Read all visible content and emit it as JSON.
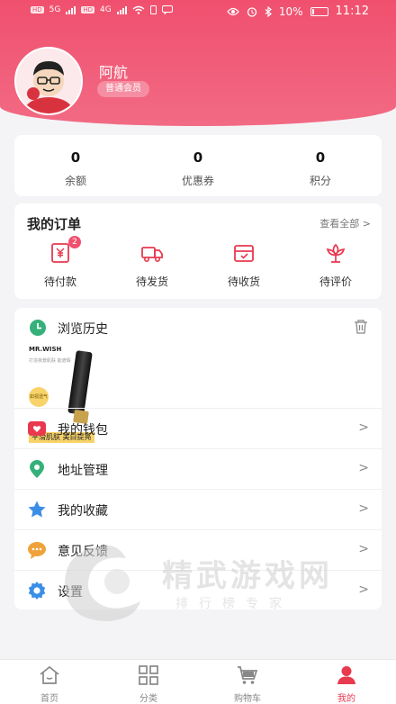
{
  "status_bar": {
    "time": "11:12",
    "battery": "10%",
    "sim1": "HD",
    "sim2": "HD",
    "net1": "5G",
    "net2": "4G"
  },
  "profile": {
    "name": "阿航",
    "member_level": "普通会员"
  },
  "stats": [
    {
      "value": "0",
      "label": "余额"
    },
    {
      "value": "0",
      "label": "优惠券"
    },
    {
      "value": "0",
      "label": "积分"
    }
  ],
  "orders": {
    "title": "我的订单",
    "view_all": "查看全部 >",
    "items": [
      {
        "label": "待付款",
        "icon": "payment-icon",
        "badge": "2"
      },
      {
        "label": "待发货",
        "icon": "truck-icon"
      },
      {
        "label": "待收货",
        "icon": "box-icon"
      },
      {
        "label": "待评价",
        "icon": "flower-icon"
      }
    ]
  },
  "history": {
    "title": "浏览历史",
    "product": {
      "brand": "MR.WISH",
      "fine_print": "打造夜景肌肤 能遮瑕",
      "tag": "如视透气",
      "caption": "平滑肌肤 美白提亮"
    }
  },
  "menu": [
    {
      "label": "我的钱包",
      "icon": "wallet-icon",
      "color": "#e8394f"
    },
    {
      "label": "地址管理",
      "icon": "location-icon",
      "color": "#35b07a"
    },
    {
      "label": "我的收藏",
      "icon": "star-icon",
      "color": "#3a8ee6"
    },
    {
      "label": "意见反馈",
      "icon": "chat-icon",
      "color": "#f0a23a"
    },
    {
      "label": "设置",
      "icon": "gear-icon",
      "color": "#3a8ee6"
    }
  ],
  "watermark": {
    "title": "精武游戏网",
    "subtitle": "排行榜专家"
  },
  "tabbar": [
    {
      "label": "首页",
      "icon": "home-icon"
    },
    {
      "label": "分类",
      "icon": "grid-icon"
    },
    {
      "label": "购物车",
      "icon": "cart-icon"
    },
    {
      "label": "我的",
      "icon": "user-icon",
      "active": true
    }
  ],
  "colors": {
    "brand": "#f0506e",
    "active_tab": "#e8394f"
  }
}
